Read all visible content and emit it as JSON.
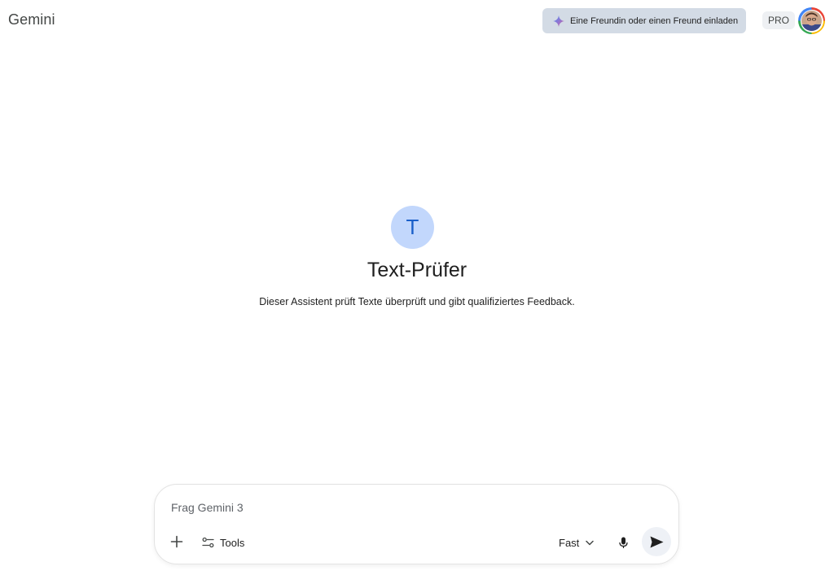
{
  "header": {
    "brand": "Gemini",
    "invite_label": "Eine Freundin oder einen Freund einladen",
    "pro_label": "PRO"
  },
  "gem": {
    "initial": "T",
    "title": "Text-Prüfer",
    "description": "Dieser Assistent prüft Texte überprüft und gibt qualifiziertes Feedback."
  },
  "prompt": {
    "placeholder": "Frag Gemini 3",
    "value": "",
    "tools_label": "Tools",
    "model_label": "Fast"
  },
  "icons": {
    "invite": "sparkle-icon",
    "plus": "plus-icon",
    "tools": "tools-sliders-icon",
    "model_dropdown": "chevron-down-icon",
    "mic": "microphone-icon",
    "send": "send-icon"
  },
  "colors": {
    "invite_bg": "#d3dbe5",
    "gem_icon_bg": "#c2d7fc",
    "gem_icon_fg": "#1a5fc9",
    "send_bg": "#eef1f6"
  }
}
